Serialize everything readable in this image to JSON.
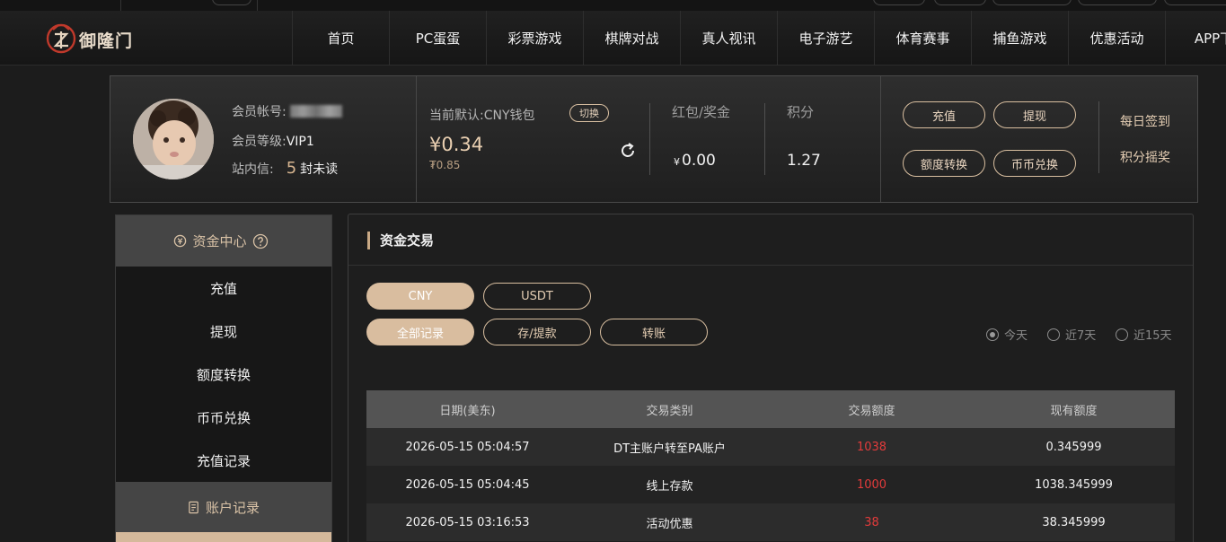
{
  "brand": {
    "name": "御隆门",
    "accent": "#d9bd9f",
    "logo_red": "#c0392b"
  },
  "nav": {
    "items": [
      "首页",
      "PC蛋蛋",
      "彩票游戏",
      "棋牌对战",
      "真人视讯",
      "电子游艺",
      "体育赛事",
      "捕鱼游戏",
      "优惠活动",
      "APP下"
    ]
  },
  "profile": {
    "account_label": "会员帐号:",
    "level_label": "会员等级:",
    "level_value": "VIP1",
    "message_label": "站内信:",
    "message_count": "5",
    "message_suffix": "封未读",
    "wallet_label": "当前默认:CNY钱包",
    "switch_label": "切换",
    "balance": "¥0.34",
    "balance_sub": "₮0.85",
    "bonus_label": "红包/奖金",
    "bonus_currency": "¥",
    "bonus_value": "0.00",
    "points_label": "积分",
    "points_value": "1.27",
    "buttons": {
      "deposit": "充值",
      "withdraw": "提现",
      "transfer": "额度转换",
      "exchange": "币币兑换"
    },
    "daily_signin": "每日签到",
    "points_lottery": "积分摇奖"
  },
  "sidebar": {
    "fund_center": "资金中心",
    "items": [
      "充值",
      "提现",
      "额度转换",
      "币币兑换",
      "充值记录"
    ],
    "account_records": "账户记录"
  },
  "main": {
    "title": "资金交易",
    "currency_tabs": [
      "CNY",
      "USDT"
    ],
    "type_tabs": [
      "全部记录",
      "存/提款",
      "转账"
    ],
    "ranges": [
      "今天",
      "近7天",
      "近15天"
    ],
    "table": {
      "headers": [
        "日期(美东)",
        "交易类别",
        "交易额度",
        "现有额度"
      ],
      "rows": [
        [
          "2026-05-15 05:04:57",
          "DT主账户转至PA账户",
          "1038",
          "0.345999"
        ],
        [
          "2026-05-15 05:04:45",
          "线上存款",
          "1000",
          "1038.345999"
        ],
        [
          "2026-05-15 03:16:53",
          "活动优惠",
          "38",
          "38.345999"
        ]
      ]
    }
  }
}
